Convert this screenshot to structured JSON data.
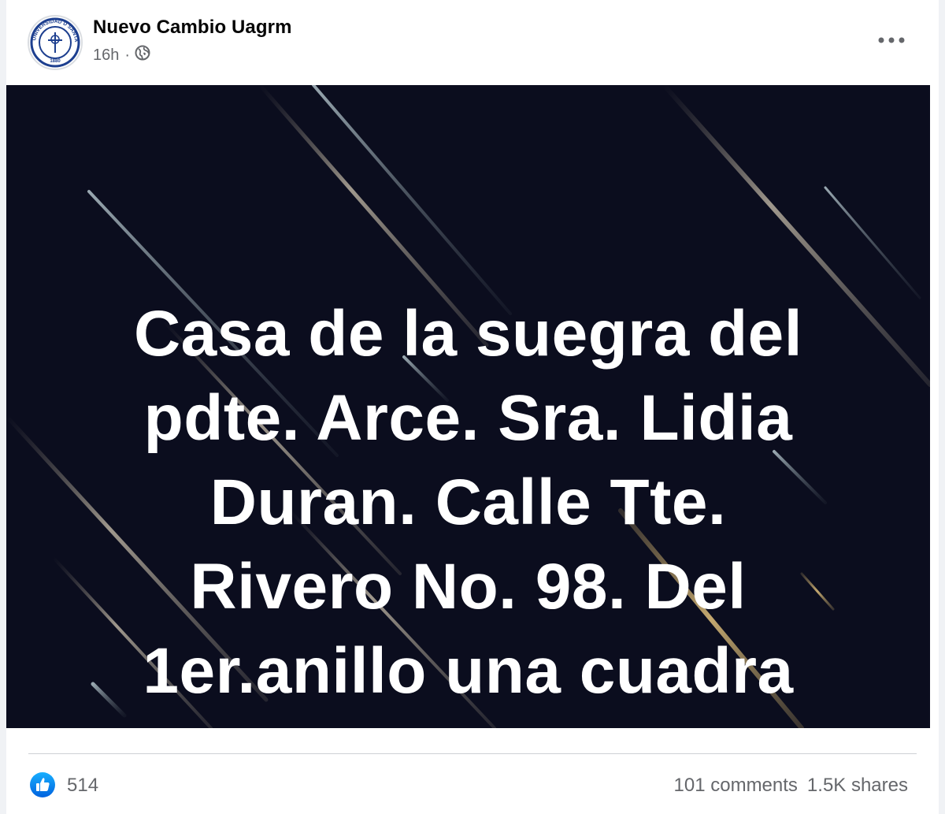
{
  "post": {
    "author": "Nuevo Cambio Uagrm",
    "time": "16h",
    "separator": "·",
    "avatar_text": "UNIVERSIDAD D SANTA CRUZ",
    "avatar_year": "1880",
    "privacy_icon": "globe-icon",
    "menu_icon": "more-options-icon"
  },
  "image": {
    "lines": [
      "Casa de la suegra del",
      "pdte. Arce. Sra. Lidia",
      "Duran. Calle Tte.",
      "Rivero No. 98. Del",
      "1er.anillo una cuadra"
    ],
    "background_color": "#0b0d1e",
    "text_color": "#ffffff"
  },
  "footer": {
    "likes": "514",
    "comments": "101 comments",
    "shares": "1.5K shares",
    "like_color": "#1877f2"
  }
}
